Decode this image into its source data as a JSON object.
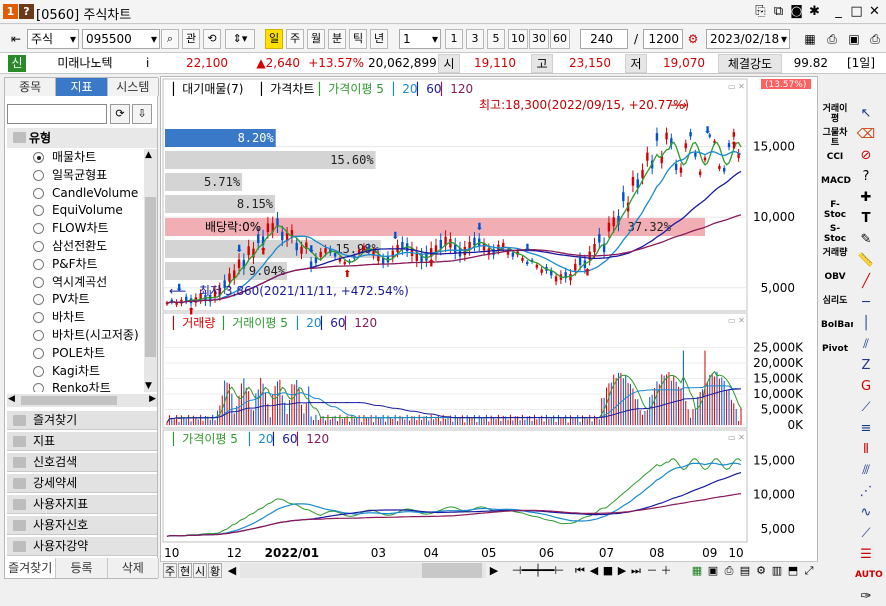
{
  "window": {
    "badge_num": "1",
    "badge_q": "?",
    "title": "[0560] 주식차트"
  },
  "toolbar": {
    "market": "주식",
    "code": "095500",
    "btn_watch": "관",
    "periods": [
      "일",
      "주",
      "월",
      "분",
      "틱",
      "년"
    ],
    "period_num": "1",
    "minute_buttons": [
      "1",
      "3",
      "5",
      "10",
      "30",
      "60"
    ],
    "count": "240",
    "slash": "/",
    "total": "1200",
    "date": "2023/02/18"
  },
  "infobar": {
    "flag": "신",
    "name": "미래나노텍",
    "price": "22,100",
    "change": "▲2,640",
    "change_pct": "+13.57%",
    "volume": "20,062,899",
    "open_label": "시",
    "open": "19,110",
    "high_label": "고",
    "high": "23,150",
    "low_label": "저",
    "low": "19,070",
    "strength_label": "체결강도",
    "strength": "99.82",
    "period_badge": "[1일]"
  },
  "left": {
    "tabs": [
      "종목",
      "지표",
      "시스템"
    ],
    "group_title": "유형",
    "items": [
      "매물차트",
      "일목균형표",
      "CandleVolume",
      "EquiVolume",
      "FLOW차트",
      "삼선전환도",
      "P&F차트",
      "역시계곡선",
      "PV차트",
      "바차트",
      "바차트(시고저종)",
      "POLE차트",
      "Kagi차트",
      "Renko차트"
    ],
    "sections": [
      "즐겨찾기",
      "지표",
      "신호검색",
      "강세약세",
      "사용자지표",
      "사용자신호",
      "사용자강약"
    ],
    "bottom_tabs": [
      "즐겨찾기",
      "등록",
      "삭제"
    ]
  },
  "chart": {
    "top_badge": "(13.57%)",
    "legend1": {
      "a": "대기매물(7)",
      "b": "가격차트",
      "c": "가격이평",
      "d": "5",
      "e": "20",
      "f": "60",
      "g": "120"
    },
    "legend2": {
      "a": "거래량",
      "b": "거래이평",
      "c": "5",
      "d": "20",
      "e": "60",
      "f": "120"
    },
    "legend3": {
      "a": "가격이평",
      "b": "5",
      "c": "20",
      "d": "60",
      "e": "120"
    },
    "price_axis": [
      "15,000",
      "10,000",
      "5,000"
    ],
    "volume_axis": [
      "25,000K",
      "20,000K",
      "15,000K",
      "10,000K",
      "5,000K",
      "0K"
    ],
    "ma_axis": [
      "15,000",
      "10,000",
      "5,000"
    ],
    "x_axis": [
      "10",
      "12",
      "2022/01",
      "03",
      "04",
      "05",
      "06",
      "07",
      "08",
      "09",
      "10"
    ],
    "supply_bars": [
      {
        "label": "8.20%",
        "value": 8.2,
        "highlight": true
      },
      {
        "label": "15.60%",
        "value": 15.6
      },
      {
        "label": "5.71%",
        "value": 5.71
      },
      {
        "label": "8.15%",
        "value": 8.15
      },
      {
        "label": "37.32%",
        "value": 37.32,
        "current": true
      },
      {
        "label": "15.98%",
        "value": 15.98
      },
      {
        "label": "9.04%",
        "value": 9.04
      }
    ],
    "annotations": {
      "high": "최고:18,300(2022/09/15, +20.77%)",
      "low": "최저 3,860(2021/11/11, +472.54%)",
      "dividend": "배당락:0%"
    }
  },
  "right_panel": [
    "거래이평",
    "그물차트",
    "CCI",
    "MACD",
    "F-Stoc",
    "S-Stoc",
    "거래량",
    "OBV",
    "심리도",
    "BoIBand",
    "Pivot"
  ],
  "bottom_tabs": [
    "주",
    "현",
    "시",
    "황"
  ],
  "colors": {
    "up": "#d40000",
    "down": "#0050d0",
    "ma5": "#2e9a2e",
    "ma20": "#1a8ad0",
    "ma60": "#1a1aa0",
    "ma120": "#8a1a5a",
    "band": "#f0a0a8",
    "accent": "#3a78c8"
  }
}
